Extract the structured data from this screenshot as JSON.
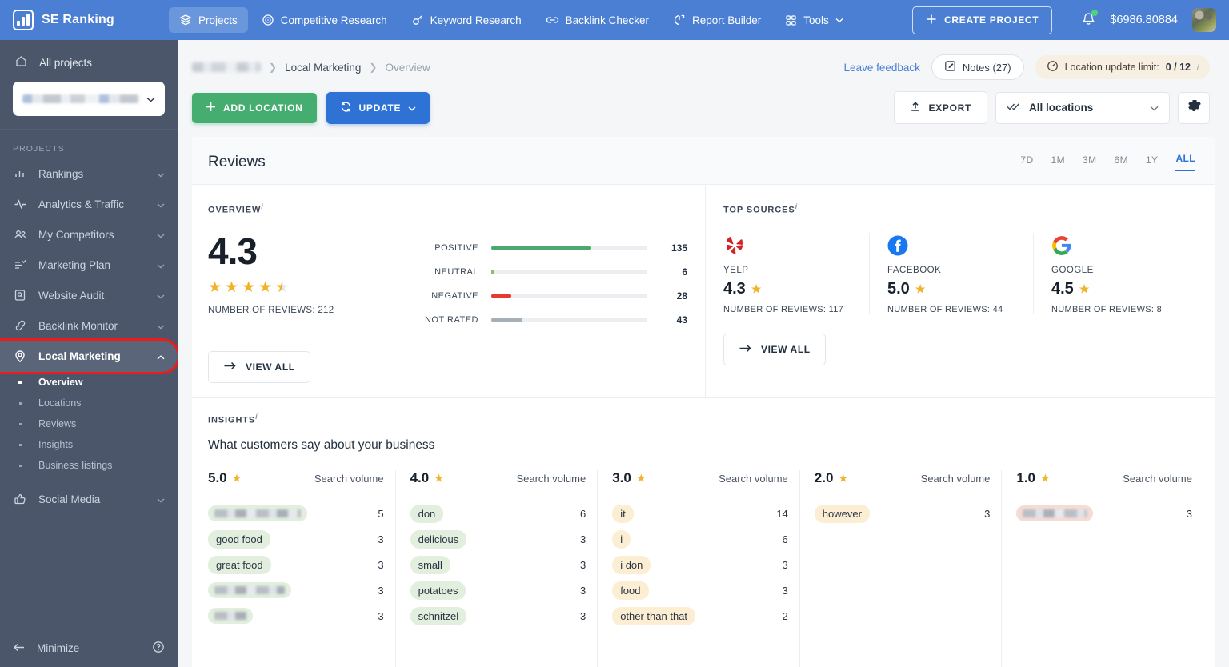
{
  "topbar": {
    "brand": "SE Ranking",
    "nav": [
      {
        "label": "Projects",
        "icon": "layers-icon",
        "active": true
      },
      {
        "label": "Competitive Research",
        "icon": "target-icon",
        "active": false
      },
      {
        "label": "Keyword Research",
        "icon": "key-icon",
        "active": false
      },
      {
        "label": "Backlink Checker",
        "icon": "link-icon",
        "active": false
      },
      {
        "label": "Report Builder",
        "icon": "report-icon",
        "active": false
      },
      {
        "label": "Tools",
        "icon": "grid-icon",
        "active": false
      }
    ],
    "create_project": "CREATE PROJECT",
    "balance": "$6986.80884"
  },
  "sidebar": {
    "all_projects": "All projects",
    "section_label": "PROJECTS",
    "items": [
      {
        "label": "Rankings",
        "icon": "bar-chart-icon"
      },
      {
        "label": "Analytics & Traffic",
        "icon": "pulse-icon"
      },
      {
        "label": "My Competitors",
        "icon": "people-icon"
      },
      {
        "label": "Marketing Plan",
        "icon": "checklist-icon"
      },
      {
        "label": "Website Audit",
        "icon": "audit-icon"
      },
      {
        "label": "Backlink Monitor",
        "icon": "chain-icon"
      },
      {
        "label": "Local Marketing",
        "icon": "pin-icon"
      },
      {
        "label": "Social Media",
        "icon": "thumbs-up-icon"
      }
    ],
    "sub_items": [
      {
        "label": "Overview",
        "active": true
      },
      {
        "label": "Locations",
        "active": false
      },
      {
        "label": "Reviews",
        "active": false
      },
      {
        "label": "Insights",
        "active": false
      },
      {
        "label": "Business listings",
        "active": false
      }
    ],
    "minimize": "Minimize"
  },
  "breadcrumb": {
    "project": "",
    "section": "Local Marketing",
    "page": "Overview"
  },
  "header": {
    "leave_feedback": "Leave feedback",
    "notes": "Notes (27)",
    "limit_label": "Location update limit:",
    "limit_value": "0 / 12"
  },
  "actions": {
    "add_location": "ADD LOCATION",
    "update": "UPDATE",
    "export": "EXPORT",
    "locations_filter": "All locations"
  },
  "reviews": {
    "title": "Reviews",
    "ranges": [
      "7D",
      "1M",
      "3M",
      "6M",
      "1Y",
      "ALL"
    ],
    "active_range": "ALL",
    "overview": {
      "label": "OVERVIEW",
      "rating": "4.3",
      "stars": 4.5,
      "number_of_reviews": "NUMBER OF REVIEWS: 212",
      "view_all": "VIEW ALL",
      "breakdown": [
        {
          "name": "POSITIVE",
          "value": "135",
          "pct": 64,
          "color": "#4aa96c"
        },
        {
          "name": "NEUTRAL",
          "value": "6",
          "pct": 2,
          "color": "#8cc152"
        },
        {
          "name": "NEGATIVE",
          "value": "28",
          "pct": 13,
          "color": "#e63a2e"
        },
        {
          "name": "NOT RATED",
          "value": "43",
          "pct": 20,
          "color": "#a8b0b7"
        }
      ]
    },
    "top_sources": {
      "label": "TOP SOURCES",
      "view_all": "VIEW ALL",
      "items": [
        {
          "name": "YELP",
          "rating": "4.3",
          "reviews": "NUMBER OF REVIEWS: 117",
          "icon": "yelp-icon"
        },
        {
          "name": "FACEBOOK",
          "rating": "5.0",
          "reviews": "NUMBER OF REVIEWS: 44",
          "icon": "facebook-icon"
        },
        {
          "name": "GOOGLE",
          "rating": "4.5",
          "reviews": "NUMBER OF REVIEWS: 8",
          "icon": "google-icon"
        }
      ]
    }
  },
  "insights": {
    "label": "INSIGHTS",
    "question": "What customers say about your business",
    "search_volume_label": "Search volume",
    "columns": [
      {
        "score": "5.0",
        "tone": "green",
        "rows": [
          {
            "term": "",
            "blurred": true,
            "value": "5"
          },
          {
            "term": "good food",
            "blurred": false,
            "value": "3"
          },
          {
            "term": "great food",
            "blurred": false,
            "value": "3"
          },
          {
            "term": "",
            "blurred": true,
            "value": "3"
          },
          {
            "term": "",
            "blurred": true,
            "value": "3"
          }
        ]
      },
      {
        "score": "4.0",
        "tone": "green",
        "rows": [
          {
            "term": "don",
            "blurred": false,
            "value": "6"
          },
          {
            "term": "delicious",
            "blurred": false,
            "value": "3"
          },
          {
            "term": "small",
            "blurred": false,
            "value": "3"
          },
          {
            "term": "potatoes",
            "blurred": false,
            "value": "3"
          },
          {
            "term": "schnitzel",
            "blurred": false,
            "value": "3"
          }
        ]
      },
      {
        "score": "3.0",
        "tone": "amber",
        "rows": [
          {
            "term": "it",
            "blurred": false,
            "value": "14"
          },
          {
            "term": "i",
            "blurred": false,
            "value": "6"
          },
          {
            "term": "i don",
            "blurred": false,
            "value": "3"
          },
          {
            "term": "food",
            "blurred": false,
            "value": "3"
          },
          {
            "term": "other than that",
            "blurred": false,
            "value": "2"
          }
        ]
      },
      {
        "score": "2.0",
        "tone": "amber",
        "rows": [
          {
            "term": "however",
            "blurred": false,
            "value": "3"
          }
        ]
      },
      {
        "score": "1.0",
        "tone": "pink",
        "rows": [
          {
            "term": "",
            "blurred": true,
            "value": "3"
          }
        ]
      }
    ]
  }
}
